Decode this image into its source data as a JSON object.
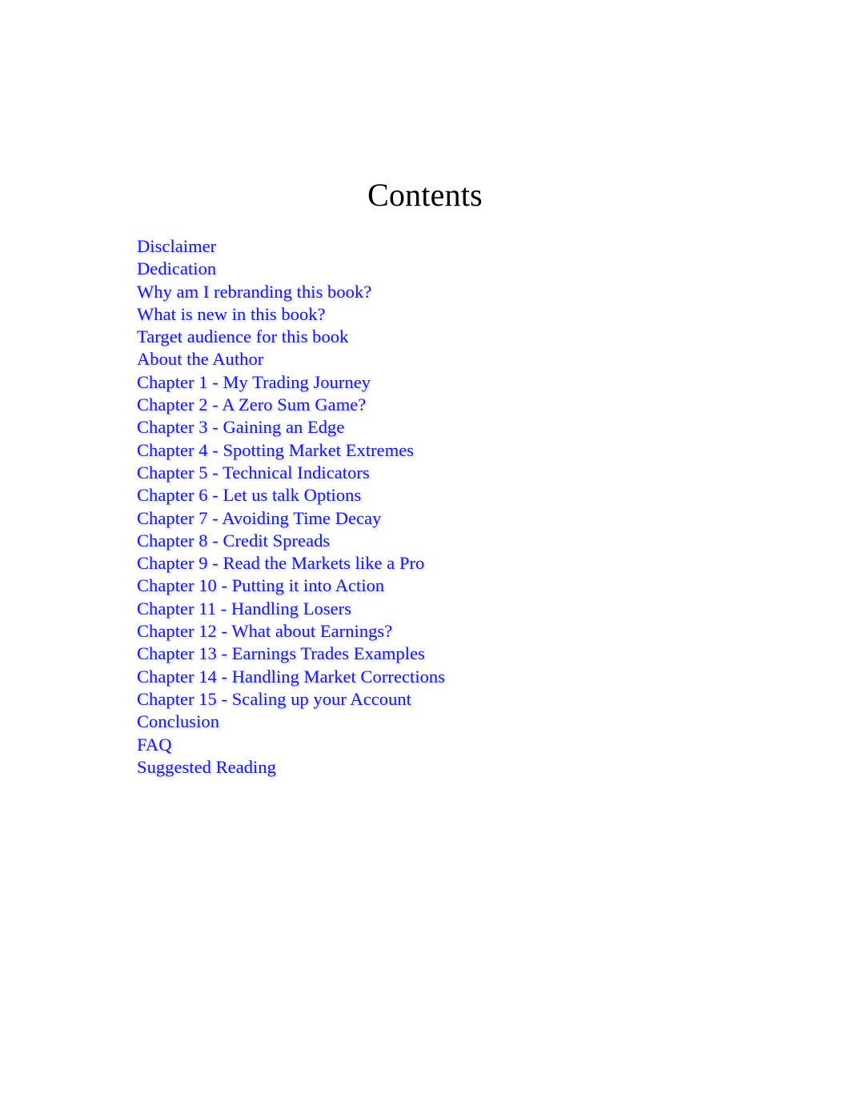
{
  "page": {
    "background_color": "#ffffff",
    "title_color": "#000000",
    "link_color": "#1a1aee",
    "link_shadow_color": "#969bd7"
  },
  "heading": {
    "title": "Contents"
  },
  "toc": {
    "items": [
      {
        "label": "Disclaimer"
      },
      {
        "label": "Dedication"
      },
      {
        "label": "Why am I rebranding this book?"
      },
      {
        "label": "What is new in this book?"
      },
      {
        "label": "Target audience for this book"
      },
      {
        "label": "About the Author"
      },
      {
        "label": "Chapter 1 - My Trading Journey"
      },
      {
        "label": "Chapter 2 - A Zero Sum Game?"
      },
      {
        "label": "Chapter 3 - Gaining an Edge"
      },
      {
        "label": "Chapter 4 - Spotting Market Extremes"
      },
      {
        "label": "Chapter 5 - Technical Indicators"
      },
      {
        "label": "Chapter 6 - Let us talk Options"
      },
      {
        "label": "Chapter 7 - Avoiding Time Decay"
      },
      {
        "label": "Chapter 8 - Credit Spreads"
      },
      {
        "label": "Chapter 9 - Read the Markets like a Pro"
      },
      {
        "label": "Chapter 10 - Putting it into Action"
      },
      {
        "label": "Chapter 11 - Handling Losers"
      },
      {
        "label": "Chapter 12 - What about Earnings?"
      },
      {
        "label": "Chapter 13 - Earnings Trades Examples"
      },
      {
        "label": "Chapter 14 - Handling Market Corrections"
      },
      {
        "label": "Chapter 15 - Scaling up your Account"
      },
      {
        "label": "Conclusion"
      },
      {
        "label": "FAQ"
      },
      {
        "label": "Suggested Reading"
      }
    ]
  }
}
